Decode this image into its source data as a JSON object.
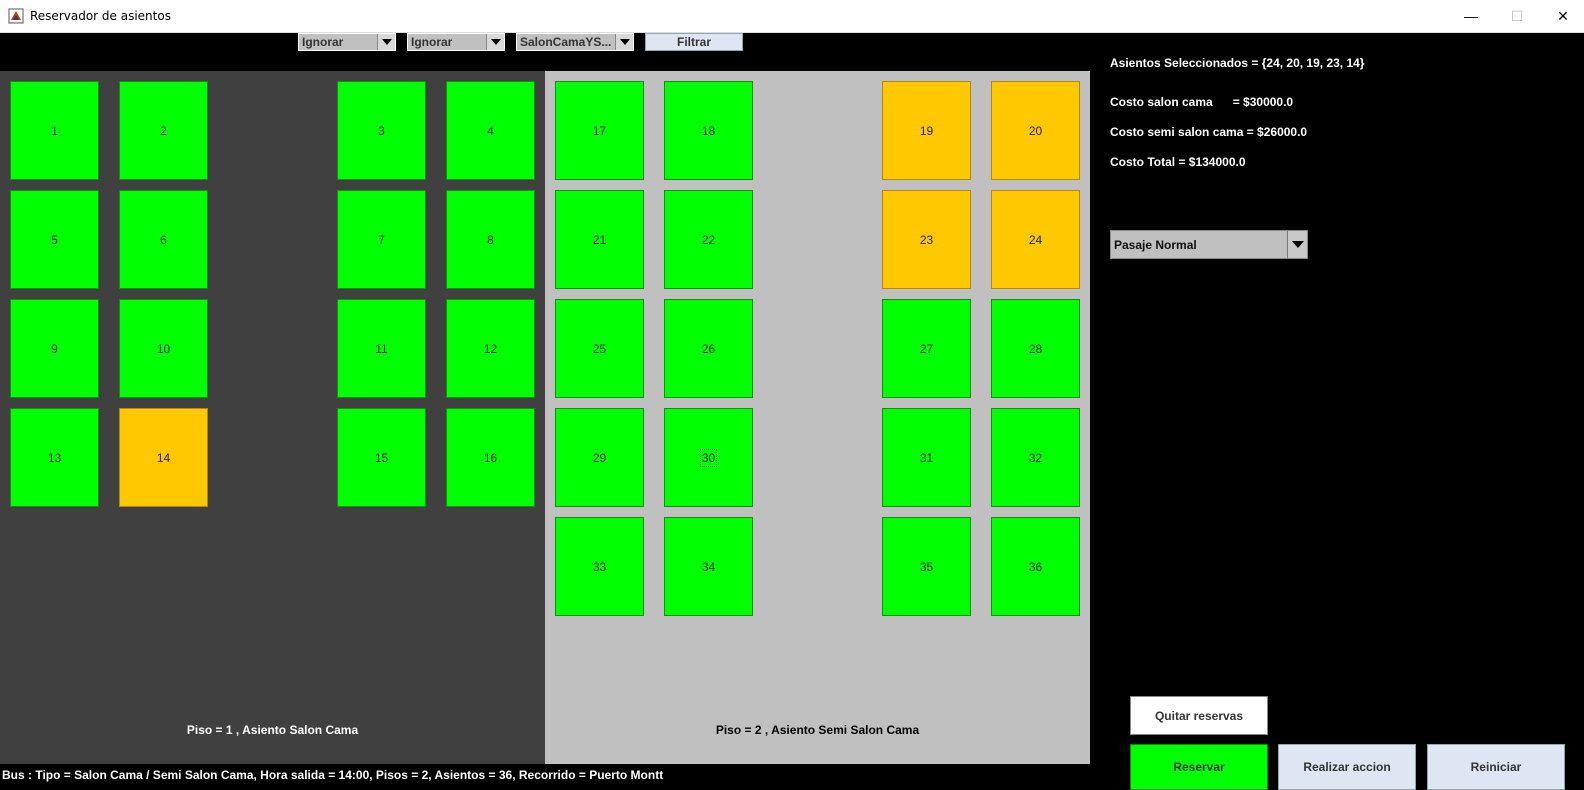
{
  "window": {
    "title": "Reservador de asientos",
    "minimize_glyph": "—",
    "maximize_glyph": "☐",
    "close_glyph": "✕"
  },
  "filters": {
    "combo1": "Ignorar",
    "combo2": "Ignorar",
    "combo3": "SalonCamaYS...",
    "filter_label": "Filtrar"
  },
  "colors": {
    "free_seat": "#00ff00",
    "selected_seat": "#ffc800",
    "floor1_bg": "#404040",
    "floor2_bg": "#c0c0c0"
  },
  "floors": [
    {
      "label": "Piso = 1 , Asiento Salon Cama",
      "seats": [
        {
          "n": "1",
          "status": "free"
        },
        {
          "n": "2",
          "status": "free"
        },
        {
          "n": "3",
          "status": "free"
        },
        {
          "n": "4",
          "status": "free"
        },
        {
          "n": "5",
          "status": "free"
        },
        {
          "n": "6",
          "status": "free"
        },
        {
          "n": "7",
          "status": "free"
        },
        {
          "n": "8",
          "status": "free"
        },
        {
          "n": "9",
          "status": "free"
        },
        {
          "n": "10",
          "status": "free"
        },
        {
          "n": "11",
          "status": "free"
        },
        {
          "n": "12",
          "status": "free"
        },
        {
          "n": "13",
          "status": "free"
        },
        {
          "n": "14",
          "status": "selected"
        },
        {
          "n": "15",
          "status": "free"
        },
        {
          "n": "16",
          "status": "free"
        }
      ]
    },
    {
      "label": "Piso = 2 , Asiento Semi Salon Cama",
      "seats": [
        {
          "n": "17",
          "status": "free"
        },
        {
          "n": "18",
          "status": "free"
        },
        {
          "n": "19",
          "status": "selected"
        },
        {
          "n": "20",
          "status": "selected"
        },
        {
          "n": "21",
          "status": "free"
        },
        {
          "n": "22",
          "status": "free"
        },
        {
          "n": "23",
          "status": "selected"
        },
        {
          "n": "24",
          "status": "selected"
        },
        {
          "n": "25",
          "status": "free"
        },
        {
          "n": "26",
          "status": "free"
        },
        {
          "n": "27",
          "status": "free"
        },
        {
          "n": "28",
          "status": "free"
        },
        {
          "n": "29",
          "status": "free"
        },
        {
          "n": "30",
          "status": "free",
          "focused": true
        },
        {
          "n": "31",
          "status": "free"
        },
        {
          "n": "32",
          "status": "free"
        },
        {
          "n": "33",
          "status": "free"
        },
        {
          "n": "34",
          "status": "free"
        },
        {
          "n": "35",
          "status": "free"
        },
        {
          "n": "36",
          "status": "free"
        }
      ]
    }
  ],
  "summary": {
    "selected": "Asientos Seleccionados = {24, 20, 19, 23, 14}",
    "cost_salon": "Costo salon cama      = $30000.0",
    "cost_semi": "Costo semi salon cama = $26000.0",
    "total": "Costo Total = $134000.0"
  },
  "ticket_type": "Pasaje Normal",
  "buttons": {
    "quitar": "Quitar reservas",
    "reservar": "Reservar",
    "accion": "Realizar accion",
    "reiniciar": "Reiniciar"
  },
  "status": "Bus : Tipo = Salon Cama / Semi Salon Cama, Hora salida = 14:00, Pisos = 2, Asientos = 36, Recorrido = Puerto Montt"
}
